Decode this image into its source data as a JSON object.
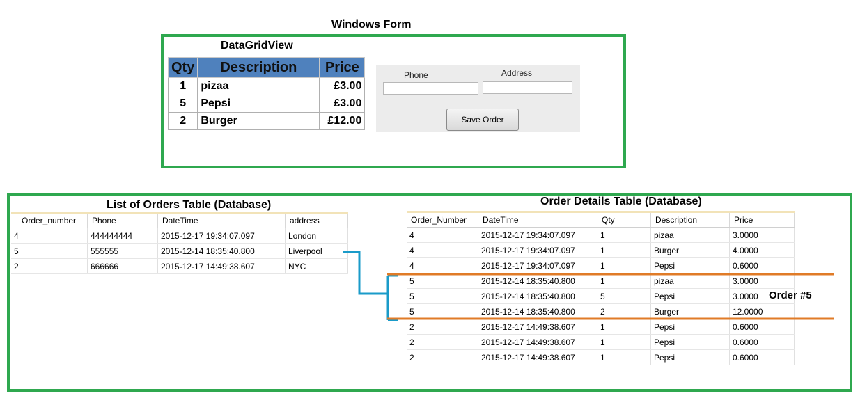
{
  "form": {
    "window_title": "Windows Form",
    "dgv_title": "DataGridView",
    "grid_headers": [
      "Qty",
      "Description",
      "Price"
    ],
    "grid_rows": [
      {
        "qty": "1",
        "desc": "pizaa",
        "price": "£3.00"
      },
      {
        "qty": "5",
        "desc": "Pepsi",
        "price": "£3.00"
      },
      {
        "qty": "2",
        "desc": "Burger",
        "price": "£12.00"
      }
    ],
    "phone_label": "Phone",
    "address_label": "Address",
    "save_label": "Save Order"
  },
  "orders_table": {
    "title": "List of Orders Table (Database)",
    "headers": [
      "Order_number",
      "Phone",
      "DateTime",
      "address"
    ],
    "rows": [
      [
        "4",
        "444444444",
        "2015-12-17 19:34:07.097",
        "London"
      ],
      [
        "5",
        "555555",
        "2015-12-14 18:35:40.800",
        "Liverpool"
      ],
      [
        "2",
        "666666",
        "2015-12-17 14:49:38.607",
        "NYC"
      ]
    ]
  },
  "details_table": {
    "title": "Order Details Table (Database)",
    "headers": [
      "Order_Number",
      "DateTime",
      "Qty",
      "Description",
      "Price"
    ],
    "rows": [
      [
        "4",
        "2015-12-17 19:34:07.097",
        "1",
        "pizaa",
        "3.0000"
      ],
      [
        "4",
        "2015-12-17 19:34:07.097",
        "1",
        "Burger",
        "4.0000"
      ],
      [
        "4",
        "2015-12-17 19:34:07.097",
        "1",
        "Pepsi",
        "0.6000"
      ],
      [
        "5",
        "2015-12-14 18:35:40.800",
        "1",
        "pizaa",
        "3.0000"
      ],
      [
        "5",
        "2015-12-14 18:35:40.800",
        "5",
        "Pepsi",
        "3.0000"
      ],
      [
        "5",
        "2015-12-14 18:35:40.800",
        "2",
        "Burger",
        "12.0000"
      ],
      [
        "2",
        "2015-12-17 14:49:38.607",
        "1",
        "Pepsi",
        "0.6000"
      ],
      [
        "2",
        "2015-12-17 14:49:38.607",
        "1",
        "Pepsi",
        "0.6000"
      ],
      [
        "2",
        "2015-12-17 14:49:38.607",
        "1",
        "Pepsi",
        "0.6000"
      ]
    ]
  },
  "annotation": {
    "label": "Order #5"
  },
  "colors": {
    "frame": "#2fa84f",
    "connector": "#1a9bc9",
    "highlight": "#e07b27",
    "grid_header": "#4f81bd"
  }
}
